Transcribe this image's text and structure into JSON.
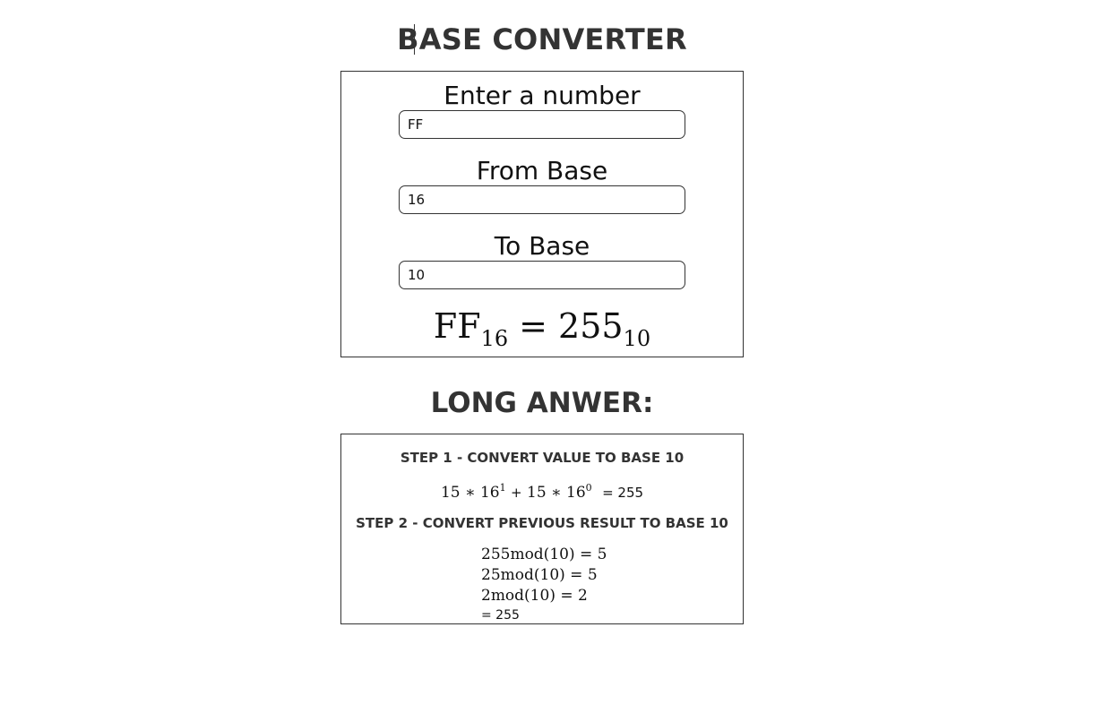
{
  "header": {
    "title": "BASE CONVERTER"
  },
  "converter": {
    "number_label": "Enter a number",
    "number_value": "FF",
    "from_label": "From Base",
    "from_value": "16",
    "to_label": "To Base",
    "to_value": "10",
    "result": {
      "input_value": "FF",
      "from_base": "16",
      "equals": "=",
      "output_value": "255",
      "to_base": "10"
    }
  },
  "long_answer": {
    "title": "LONG ANWER:",
    "step1": {
      "heading": "STEP 1 - CONVERT VALUE TO BASE 10",
      "terms": [
        {
          "coef": "15",
          "op": "∗",
          "base": "16",
          "exp": "1"
        },
        {
          "coef": "15",
          "op": "∗",
          "base": "16",
          "exp": "0"
        }
      ],
      "plus": "+",
      "result": "= 255"
    },
    "step2": {
      "heading": "STEP 2 - CONVERT PREVIOUS RESULT TO BASE 10",
      "lines": [
        "255mod(10) = 5",
        "25mod(10) = 5",
        "2mod(10) = 2"
      ],
      "final": "= 255"
    }
  }
}
